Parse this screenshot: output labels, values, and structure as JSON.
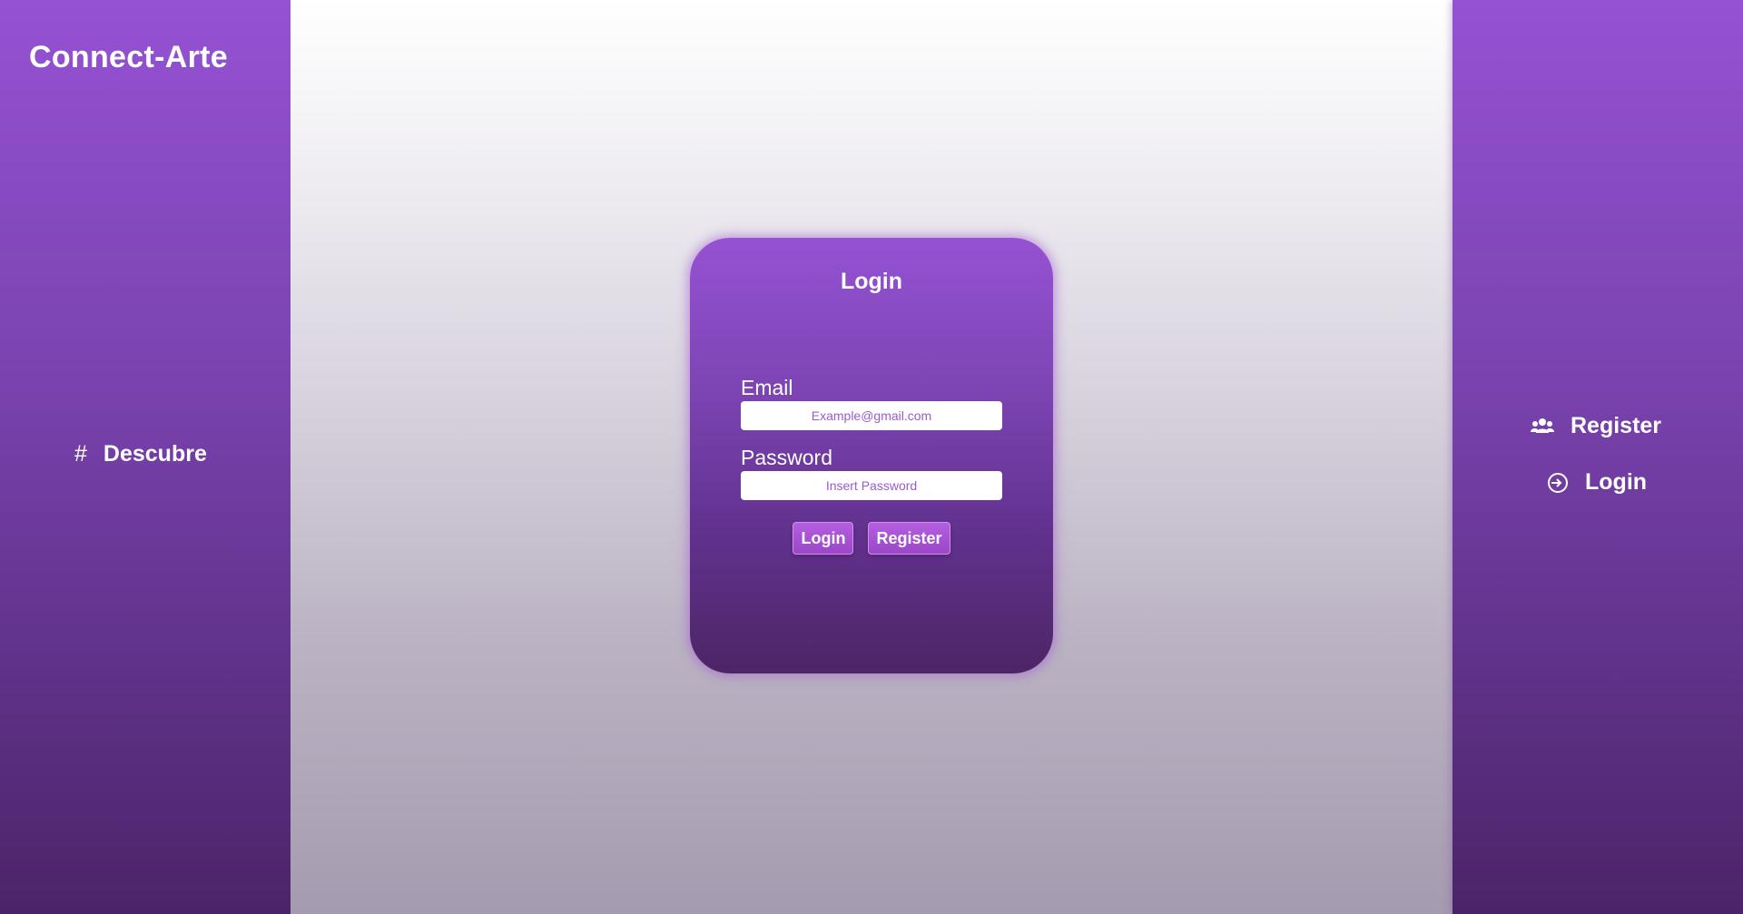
{
  "brand": {
    "title": "Connect-Arte"
  },
  "left_nav": {
    "items": [
      {
        "icon": "hash-icon",
        "label": "Descubre"
      }
    ]
  },
  "right_nav": {
    "items": [
      {
        "icon": "users-icon",
        "label": "Register"
      },
      {
        "icon": "login-icon",
        "label": "Login"
      }
    ]
  },
  "login_card": {
    "title": "Login",
    "email": {
      "label": "Email",
      "placeholder": "Example@gmail.com",
      "value": ""
    },
    "password": {
      "label": "Password",
      "placeholder": "Insert Password",
      "value": ""
    },
    "buttons": {
      "login": "Login",
      "register": "Register"
    }
  },
  "colors": {
    "accent_top": "#9552d3",
    "accent_bottom": "#4b2468",
    "button": "#b45ee0",
    "text": "#ffffff"
  }
}
